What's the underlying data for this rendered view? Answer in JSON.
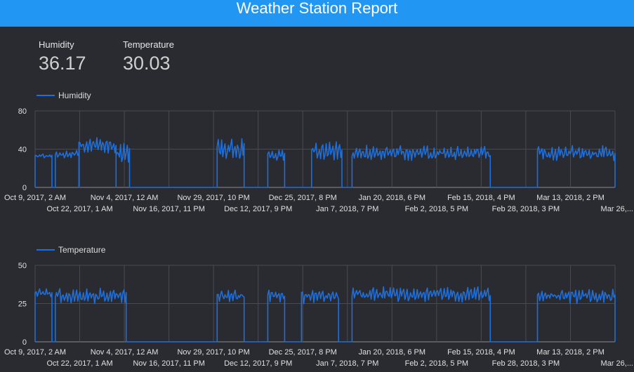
{
  "header": {
    "title": "Weather Station Report"
  },
  "scorecards": {
    "humidity": {
      "label": "Humidity",
      "value": "36.17"
    },
    "temperature": {
      "label": "Temperature",
      "value": "30.03"
    }
  },
  "colors": {
    "header": "#2196f3",
    "background": "#2a2a31",
    "series": "#1e6fd9",
    "grid": "#4a4a52"
  },
  "chart_data": [
    {
      "type": "line",
      "series": [
        {
          "name": "Humidity"
        }
      ],
      "ylim": [
        0,
        80
      ],
      "yticks": [
        0,
        40,
        80
      ],
      "grid": true,
      "legend": "top-left",
      "x_range": [
        "2017-10-09",
        "2018-03-30"
      ],
      "xtick_labels_row1": [
        "Oct 9, 2017, 2 AM",
        "Nov 4, 2017, 12 AM",
        "Nov 29, 2017, 10 PM",
        "Dec 25, 2017, 8 PM",
        "Jan 20, 2018, 6 PM",
        "Feb 15, 2018, 4 PM",
        "Mar 13, 2018, 2 PM"
      ],
      "xtick_labels_row2": [
        "Oct 22, 2017, 1 AM",
        "Nov 16, 2017, 11 PM",
        "Dec 12, 2017, 9 PM",
        "Jan 7, 2018, 7 PM",
        "Feb 2, 2018, 5 PM",
        "Feb 28, 2018, 3 PM",
        "Mar 26,..."
      ],
      "segments": [
        {
          "start": "2017-10-09",
          "end": "2017-10-14",
          "base": 33,
          "amp": 2
        },
        {
          "start": "2017-10-14",
          "end": "2017-10-15",
          "base": 0,
          "amp": 0
        },
        {
          "start": "2017-10-15",
          "end": "2017-10-22",
          "base": 35,
          "amp": 4
        },
        {
          "start": "2017-10-22",
          "end": "2017-11-02",
          "base": 44,
          "amp": 8
        },
        {
          "start": "2017-11-02",
          "end": "2017-11-06",
          "base": 36,
          "amp": 10
        },
        {
          "start": "2017-11-06",
          "end": "2017-12-02",
          "base": 0,
          "amp": 0
        },
        {
          "start": "2017-12-02",
          "end": "2017-12-10",
          "base": 40,
          "amp": 14
        },
        {
          "start": "2017-12-10",
          "end": "2017-12-17",
          "base": 0,
          "amp": 0
        },
        {
          "start": "2017-12-17",
          "end": "2017-12-22",
          "base": 34,
          "amp": 6
        },
        {
          "start": "2017-12-22",
          "end": "2017-12-30",
          "base": 0,
          "amp": 0
        },
        {
          "start": "2017-12-30",
          "end": "2018-01-08",
          "base": 38,
          "amp": 10
        },
        {
          "start": "2018-01-08",
          "end": "2018-01-11",
          "base": 0,
          "amp": 0
        },
        {
          "start": "2018-01-11",
          "end": "2018-02-21",
          "base": 36,
          "amp": 8
        },
        {
          "start": "2018-02-21",
          "end": "2018-03-07",
          "base": 0,
          "amp": 0
        },
        {
          "start": "2018-03-07",
          "end": "2018-03-30",
          "base": 36,
          "amp": 8
        }
      ]
    },
    {
      "type": "line",
      "series": [
        {
          "name": "Temperature"
        }
      ],
      "ylim": [
        0,
        50
      ],
      "yticks": [
        0,
        25,
        50
      ],
      "grid": true,
      "legend": "top-left",
      "x_range": [
        "2017-10-09",
        "2018-03-30"
      ],
      "xtick_labels_row1": [
        "Oct 9, 2017, 2 AM",
        "Nov 4, 2017, 12 AM",
        "Nov 29, 2017, 10 PM",
        "Dec 25, 2017, 8 PM",
        "Jan 20, 2018, 6 PM",
        "Feb 15, 2018, 4 PM",
        "Mar 13, 2018, 2 PM"
      ],
      "xtick_labels_row2": [
        "Oct 22, 2017, 1 AM",
        "Nov 16, 2017, 11 PM",
        "Dec 12, 2017, 9 PM",
        "Jan 7, 2018, 7 PM",
        "Feb 2, 2018, 5 PM",
        "Feb 28, 2018, 3 PM",
        "Mar 26,..."
      ],
      "segments": [
        {
          "start": "2017-10-09",
          "end": "2017-10-14",
          "base": 32,
          "amp": 3
        },
        {
          "start": "2017-10-14",
          "end": "2017-10-15",
          "base": 0,
          "amp": 0
        },
        {
          "start": "2017-10-15",
          "end": "2017-11-05",
          "base": 30,
          "amp": 5
        },
        {
          "start": "2017-11-05",
          "end": "2017-12-02",
          "base": 0,
          "amp": 0
        },
        {
          "start": "2017-12-02",
          "end": "2017-12-10",
          "base": 30,
          "amp": 4
        },
        {
          "start": "2017-12-10",
          "end": "2017-12-17",
          "base": 0,
          "amp": 0
        },
        {
          "start": "2017-12-17",
          "end": "2017-12-22",
          "base": 30,
          "amp": 5
        },
        {
          "start": "2017-12-22",
          "end": "2017-12-27",
          "base": 0,
          "amp": 0
        },
        {
          "start": "2017-12-27",
          "end": "2018-01-07",
          "base": 30,
          "amp": 5
        },
        {
          "start": "2018-01-07",
          "end": "2018-01-11",
          "base": 0,
          "amp": 0
        },
        {
          "start": "2018-01-11",
          "end": "2018-02-21",
          "base": 31,
          "amp": 5
        },
        {
          "start": "2018-02-21",
          "end": "2018-03-07",
          "base": 0,
          "amp": 0
        },
        {
          "start": "2018-03-07",
          "end": "2018-03-30",
          "base": 30,
          "amp": 5
        }
      ]
    }
  ]
}
